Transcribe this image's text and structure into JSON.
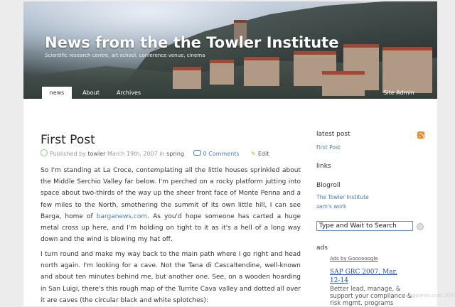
{
  "header": {
    "title": "News from the the Towler Institute",
    "description": "Scientific research centre, art school, conference venue, cinema",
    "nav": [
      {
        "label": "news",
        "active": true
      },
      {
        "label": "About",
        "active": false
      },
      {
        "label": "Archives",
        "active": false
      }
    ],
    "site_admin": "Site Admin"
  },
  "post": {
    "title": "First Post",
    "meta": {
      "published_by": "Published by",
      "author": "towler",
      "date": "March 19th, 2007",
      "in": "in",
      "category": "spring",
      "comments": "0 Comments",
      "edit": "Edit"
    },
    "para1": {
      "before": "So I'm standing at La Croce, contemplating all the little houses sprinkled about the Middle Serchio Valley far below. I'm perched on a rocky platform jutting into space about two-thirds of the way up the sheer front face of Monte Penna and a few miles to the North, smothering the summit of its own little hill, I can see Barga, home of ",
      "link": "barganews.com",
      "after": ". As you'd hope someone has carted a huge metal cross up here, and I'm holding on tight to it as it's a hell of a long way down and the wind is blowing my hat off."
    },
    "para2": "I turn round and make my way back to the main path where I go right and head north again. I'm looking for a cave. Not the Tana di Cascaltendine, well-known and about ten minutes behind me, but another one. See, on a wooden hoarding in San Luigi, there's this rough map of the Turrite Cava valley and dotted all over it are caves (the circular black and white splotches):"
  },
  "sidebar": {
    "latest_post_heading": "latest post",
    "latest_post_link": "First Post",
    "links_heading": "links",
    "blogroll_heading": "Blogroll",
    "blogroll": [
      "The Towler Institute",
      "zam's work"
    ],
    "search_value": "Type and Wait to Search",
    "ads_heading": "ads",
    "ads_by": "Ads by Goooooogle",
    "ad_title": "SAP GRC 2007, Mar, 12-14",
    "ad_body": "Better lead, manage, & support your compliance & risk mgmt. programs"
  },
  "watermark": "barganews.com 2007",
  "colors": {
    "link": "#4a7bb0",
    "accent": "#f08a24"
  }
}
